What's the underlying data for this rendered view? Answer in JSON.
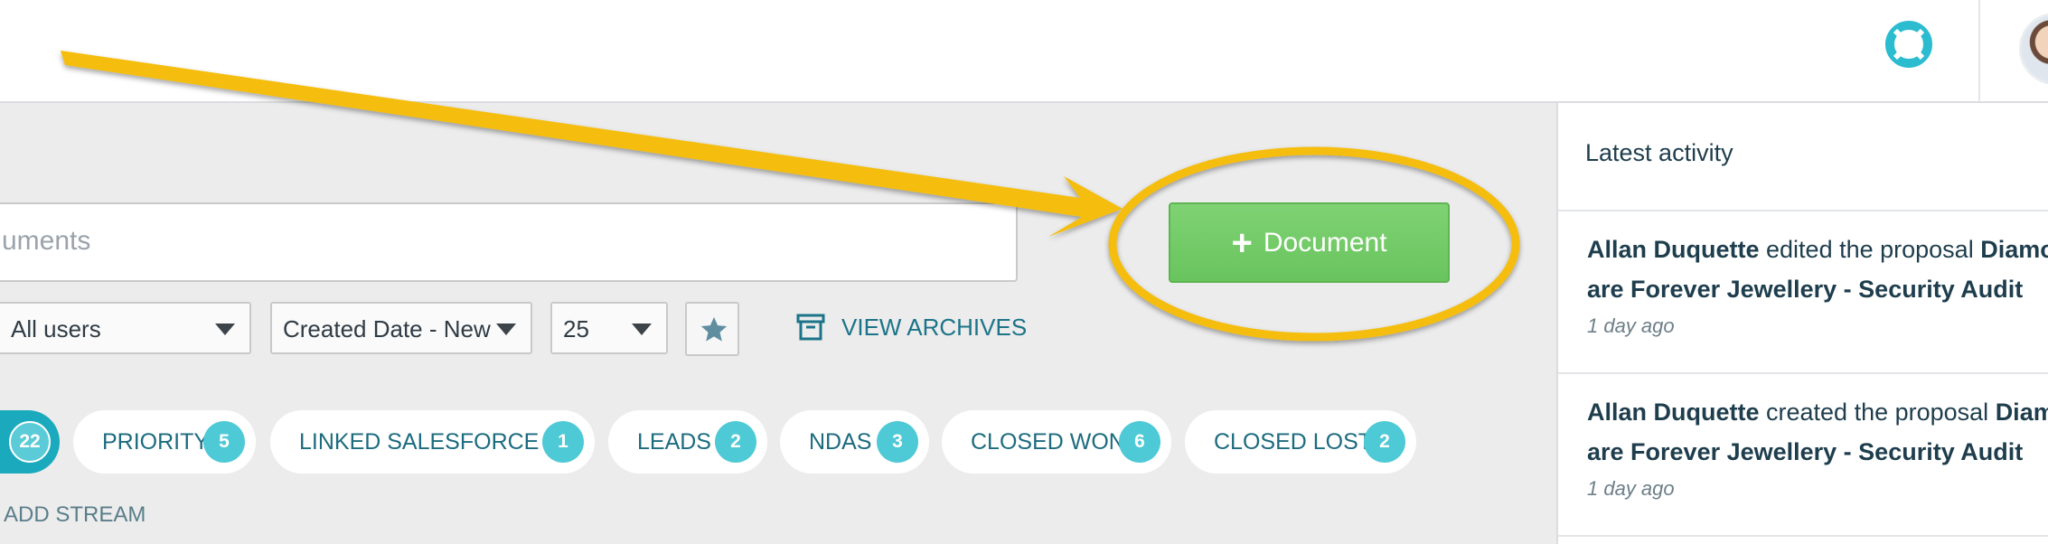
{
  "topbar": {
    "help_icon": "lifebuoy-icon",
    "avatar_icon": "user-avatar"
  },
  "search": {
    "placeholder_visible": "uments"
  },
  "add_document": {
    "label": "Document",
    "icon": "plus-icon"
  },
  "filters": {
    "users": "All users",
    "sort": "Created Date - New",
    "page_size": "25",
    "star_icon": "star-icon"
  },
  "archives": {
    "label": "VIEW ARCHIVES",
    "icon": "archive-box-icon"
  },
  "streams": {
    "all_count": "22",
    "items": [
      {
        "label": "PRIORITY",
        "count": "5"
      },
      {
        "label": "LINKED SALESFORCE ...",
        "count": "1"
      },
      {
        "label": "LEADS",
        "count": "2"
      },
      {
        "label": "NDAS",
        "count": "3"
      },
      {
        "label": "CLOSED WON",
        "count": "6"
      },
      {
        "label": "CLOSED LOST",
        "count": "2"
      }
    ],
    "add_label": "ADD STREAM"
  },
  "sidebar": {
    "title": "Latest activity",
    "activities": [
      {
        "user": "Allan Duquette",
        "action": " edited the proposal ",
        "document_line1": "Diamo",
        "document_line2": "are Forever Jewellery - Security Audit",
        "time": "1 day ago"
      },
      {
        "user": "Allan Duquette",
        "action": " created the proposal ",
        "document_line1": "Diam",
        "document_line2": "are Forever Jewellery - Security Audit",
        "time": "1 day ago"
      }
    ]
  },
  "colors": {
    "accent_teal": "#1aa9bd",
    "badge": "#4ec9d6",
    "button_green": "#6ec763",
    "annotation_yellow": "#f5bd0b"
  },
  "annotation": {
    "type": "arrow-to-ellipse",
    "color": "#f5bd0b"
  }
}
